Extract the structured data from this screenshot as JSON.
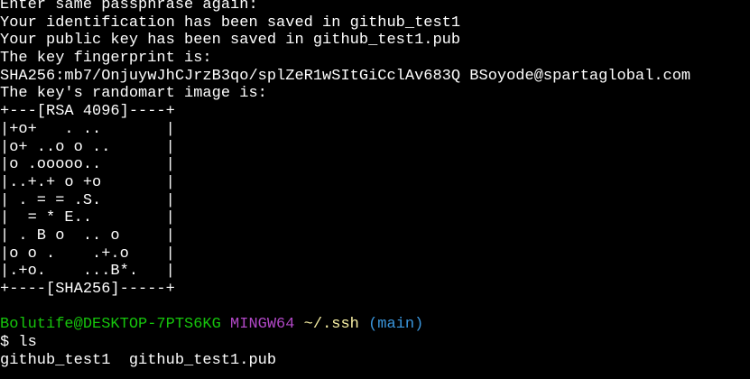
{
  "terminal": {
    "colors": {
      "background": "#000000",
      "text": "#ffffff",
      "user_host": "#16c60c",
      "env": "#b148c6",
      "path": "#f9f1a5",
      "branch": "#3a96dd"
    },
    "output_lines": [
      "Enter same passphrase again:",
      "Your identification has been saved in github_test1",
      "Your public key has been saved in github_test1.pub",
      "The key fingerprint is:",
      "SHA256:mb7/OnjuywJhCJrzB3qo/splZeR1wSItGiCclAv683Q BSoyode@spartaglobal.com",
      "The key's randomart image is:"
    ],
    "randomart": [
      "+---[RSA 4096]----+",
      "|+o+   . ..       |",
      "|o+ ..o o ..      |",
      "|o .ooooo..       |",
      "|..+.+ o +o       |",
      "| . = = .S.       |",
      "|  = * E..        |",
      "| . B o  .. o     |",
      "|o o .    .+.o    |",
      "|.+o.    ...B*.   |",
      "+----[SHA256]-----+"
    ],
    "prompt": {
      "user_host": "Bolutife@DESKTOP-7PTS6KG",
      "env": "MINGW64",
      "path": "~/.ssh",
      "branch": "(main)"
    },
    "command": "$ ls",
    "ls_output": "github_test1  github_test1.pub"
  }
}
